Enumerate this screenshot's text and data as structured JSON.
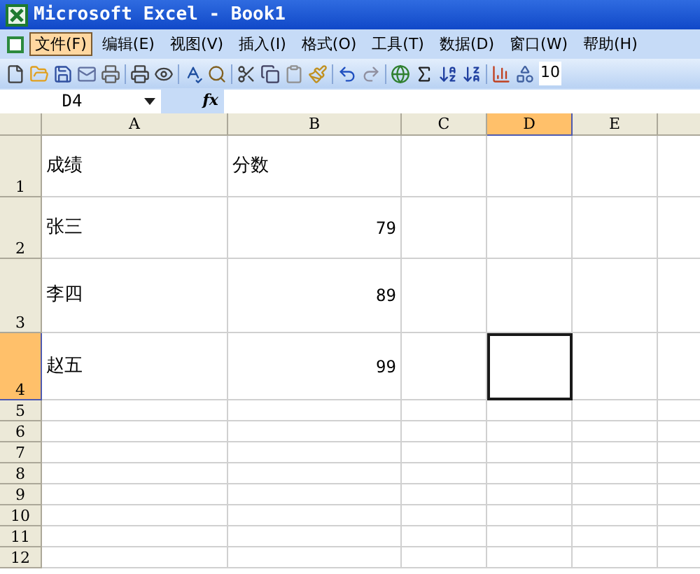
{
  "window": {
    "title": "Microsoft Excel - Book1"
  },
  "menu": [
    {
      "label": "文件(F)",
      "selected": true
    },
    {
      "label": "编辑(E)",
      "selected": false
    },
    {
      "label": "视图(V)",
      "selected": false
    },
    {
      "label": "插入(I)",
      "selected": false
    },
    {
      "label": "格式(O)",
      "selected": false
    },
    {
      "label": "工具(T)",
      "selected": false
    },
    {
      "label": "数据(D)",
      "selected": false
    },
    {
      "label": "窗口(W)",
      "selected": false
    },
    {
      "label": "帮助(H)",
      "selected": false
    }
  ],
  "toolbar": {
    "zoom": "10"
  },
  "formula_bar": {
    "name_box": "D4",
    "function_label": "fx"
  },
  "columns": [
    {
      "label": "A",
      "selected": false
    },
    {
      "label": "B",
      "selected": false
    },
    {
      "label": "C",
      "selected": false
    },
    {
      "label": "D",
      "selected": true
    },
    {
      "label": "E",
      "selected": false
    }
  ],
  "rows": [
    {
      "label": "1",
      "selected": false,
      "cells": [
        {
          "kind": "text",
          "text": "成绩",
          "selected": false
        },
        {
          "kind": "text",
          "text": "分数",
          "selected": false
        },
        {
          "kind": "empty",
          "selected": false
        },
        {
          "kind": "empty",
          "selected": false
        },
        {
          "kind": "empty",
          "selected": false
        }
      ]
    },
    {
      "label": "2",
      "selected": false,
      "cells": [
        {
          "kind": "text",
          "text": "张三",
          "selected": false
        },
        {
          "kind": "number",
          "text": "79",
          "selected": false
        },
        {
          "kind": "empty",
          "selected": false
        },
        {
          "kind": "empty",
          "selected": false
        },
        {
          "kind": "empty",
          "selected": false
        }
      ]
    },
    {
      "label": "3",
      "selected": false,
      "cells": [
        {
          "kind": "text",
          "text": "李四",
          "selected": false
        },
        {
          "kind": "number",
          "text": "89",
          "selected": false
        },
        {
          "kind": "empty",
          "selected": false
        },
        {
          "kind": "empty",
          "selected": false
        },
        {
          "kind": "empty",
          "selected": false
        }
      ]
    },
    {
      "label": "4",
      "selected": true,
      "cells": [
        {
          "kind": "text",
          "text": "赵五",
          "selected": false
        },
        {
          "kind": "number",
          "text": "99",
          "selected": false
        },
        {
          "kind": "empty",
          "selected": false
        },
        {
          "kind": "empty",
          "selected": true
        },
        {
          "kind": "empty",
          "selected": false
        }
      ]
    },
    {
      "label": "5",
      "selected": false
    },
    {
      "label": "6",
      "selected": false
    },
    {
      "label": "7",
      "selected": false
    },
    {
      "label": "8",
      "selected": false
    },
    {
      "label": "9",
      "selected": false
    },
    {
      "label": "10",
      "selected": false
    },
    {
      "label": "11",
      "selected": false
    },
    {
      "label": "12",
      "selected": false
    }
  ]
}
